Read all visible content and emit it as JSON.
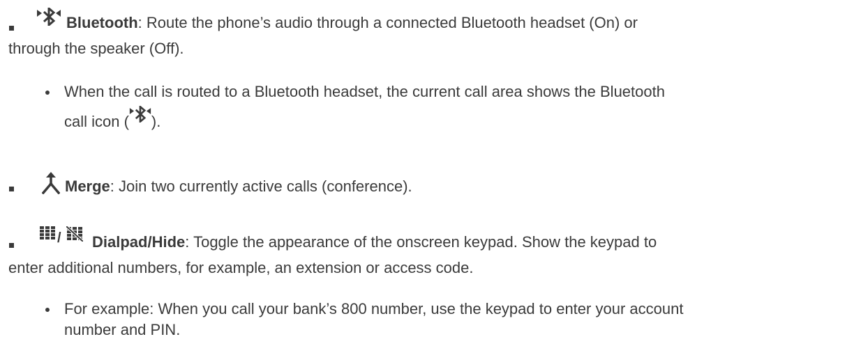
{
  "items": [
    {
      "icon": "bluetooth-call-icon",
      "term": "Bluetooth",
      "line1": ": Route the phone’s audio through a connected Bluetooth headset (On) or",
      "line2": "through the speaker (Off).",
      "sub": {
        "line1": "When the call is routed to a Bluetooth headset, the current call area shows the Bluetooth",
        "line2_before": "call icon (",
        "line2_icon": "bluetooth-call-icon",
        "line2_after": ")."
      }
    },
    {
      "icon": "merge-icon",
      "term": "Merge",
      "line1": ": Join two currently active calls (conference)."
    },
    {
      "icons": [
        "dialpad-icon",
        "hide-dialpad-icon"
      ],
      "icon_separator": "/",
      "term": "Dialpad/Hide",
      "line1": ": Toggle the appearance of the onscreen keypad. Show the keypad to",
      "line2": "enter additional numbers, for example, an extension or access code.",
      "sub": {
        "line1": "For example: When you call your bank’s 800 number, use the keypad to enter your account",
        "line2": "number and PIN."
      }
    }
  ]
}
